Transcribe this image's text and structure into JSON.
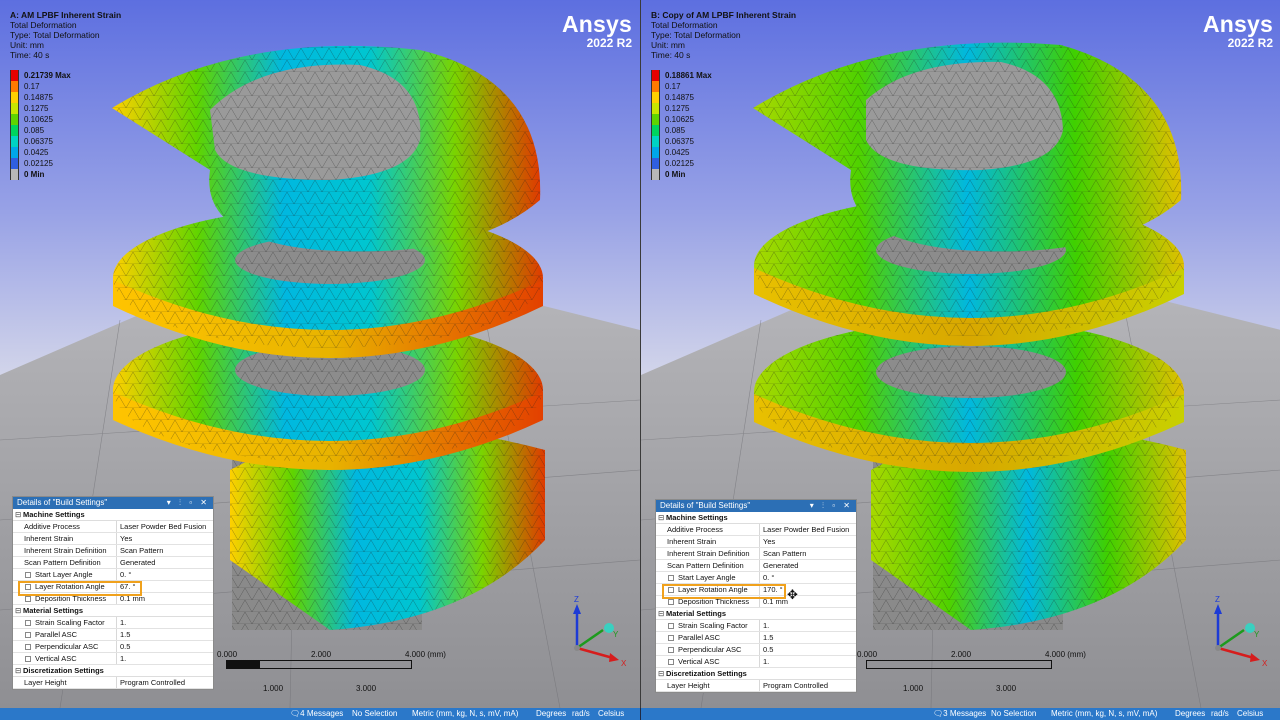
{
  "legend_colors": [
    "#e60000",
    "#ff7a00",
    "#ffd000",
    "#c8e600",
    "#5fd400",
    "#00d45e",
    "#00d4c2",
    "#00a8e8",
    "#2f5fe0",
    "#b8b8b8"
  ],
  "left": {
    "info": {
      "title": "A: AM LPBF Inherent Strain",
      "line1": "Total Deformation",
      "line2": "Type: Total Deformation",
      "line3": "Unit: mm",
      "line4": "Time: 40 s"
    },
    "brand": {
      "name": "Ansys",
      "version": "2022 R2"
    },
    "legend": [
      "0.21739 Max",
      "0.17",
      "0.14875",
      "0.1275",
      "0.10625",
      "0.085",
      "0.06375",
      "0.0425",
      "0.02125",
      "0 Min"
    ],
    "details": {
      "title": "Details of \"Build Settings\"",
      "controls": "▾ ⫶ ▫ ✕",
      "groups": [
        {
          "name": "Machine Settings",
          "rows": [
            {
              "k": "Additive Process",
              "v": "Laser Powder Bed Fusion"
            },
            {
              "k": "Inherent Strain",
              "v": "Yes"
            },
            {
              "k": "Inherent Strain Definition",
              "v": "Scan Pattern"
            },
            {
              "k": "Scan Pattern Definition",
              "v": "Generated"
            },
            {
              "k": "Start Layer Angle",
              "v": "0. °"
            },
            {
              "k": "Layer Rotation Angle",
              "v": "67. °"
            },
            {
              "k": "Deposition Thickness",
              "v": "0.1 mm"
            }
          ]
        },
        {
          "name": "Material Settings",
          "rows": [
            {
              "k": "Strain Scaling Factor",
              "v": "1."
            },
            {
              "k": "Parallel ASC",
              "v": "1.5"
            },
            {
              "k": "Perpendicular ASC",
              "v": "0.5"
            },
            {
              "k": "Vertical ASC",
              "v": "1."
            }
          ]
        },
        {
          "name": "Discretization Settings",
          "rows": [
            {
              "k": "Layer Height",
              "v": "Program Controlled"
            }
          ]
        }
      ]
    },
    "scale": {
      "t0": "0.000",
      "t2": "2.000",
      "t4": "4.000 (mm)",
      "t1": "1.000",
      "t3": "3.000"
    },
    "axis": {
      "z": "Z",
      "y": "Y",
      "x": "X"
    },
    "status": {
      "messages": "4 Messages",
      "selection": "No Selection",
      "units": "Metric (mm, kg, N, s, mV, mA)",
      "angle": "Degrees",
      "rate": "rad/s",
      "temp": "Celsius"
    }
  },
  "right": {
    "info": {
      "title": "B: Copy of AM LPBF Inherent Strain",
      "line1": "Total Deformation",
      "line2": "Type: Total Deformation",
      "line3": "Unit: mm",
      "line4": "Time: 40 s"
    },
    "brand": {
      "name": "Ansys",
      "version": "2022 R2"
    },
    "legend": [
      "0.18861 Max",
      "0.17",
      "0.14875",
      "0.1275",
      "0.10625",
      "0.085",
      "0.06375",
      "0.0425",
      "0.02125",
      "0 Min"
    ],
    "details": {
      "title": "Details of \"Build Settings\"",
      "controls": "▾ ⫶ ▫ ✕",
      "groups": [
        {
          "name": "Machine Settings",
          "rows": [
            {
              "k": "Additive Process",
              "v": "Laser Powder Bed Fusion"
            },
            {
              "k": "Inherent Strain",
              "v": "Yes"
            },
            {
              "k": "Inherent Strain Definition",
              "v": "Scan Pattern"
            },
            {
              "k": "Scan Pattern Definition",
              "v": "Generated"
            },
            {
              "k": "Start Layer Angle",
              "v": "0. °"
            },
            {
              "k": "Layer Rotation Angle",
              "v": "170. °"
            },
            {
              "k": "Deposition Thickness",
              "v": "0.1 mm"
            }
          ]
        },
        {
          "name": "Material Settings",
          "rows": [
            {
              "k": "Strain Scaling Factor",
              "v": "1."
            },
            {
              "k": "Parallel ASC",
              "v": "1.5"
            },
            {
              "k": "Perpendicular ASC",
              "v": "0.5"
            },
            {
              "k": "Vertical ASC",
              "v": "1."
            }
          ]
        },
        {
          "name": "Discretization Settings",
          "rows": [
            {
              "k": "Layer Height",
              "v": "Program Controlled"
            }
          ]
        }
      ]
    },
    "scale": {
      "t0": "0.000",
      "t2": "2.000",
      "t4": "4.000 (mm)",
      "t1": "1.000",
      "t3": "3.000"
    },
    "axis": {
      "z": "Z",
      "y": "Y",
      "x": "X"
    },
    "status": {
      "messages": "3 Messages",
      "selection": "No Selection",
      "units": "Metric (mm, kg, N, s, mV, mA)",
      "angle": "Degrees",
      "rate": "rad/s",
      "temp": "Celsius"
    }
  }
}
